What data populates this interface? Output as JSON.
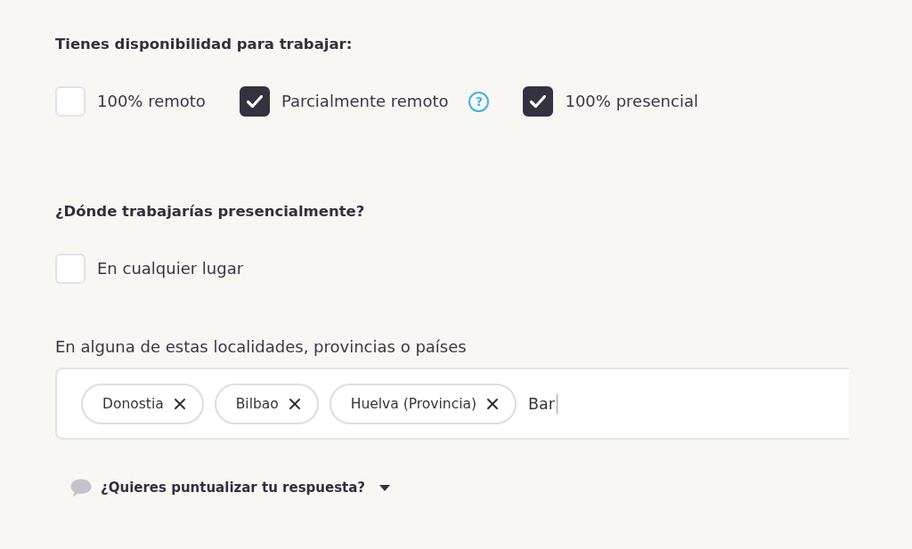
{
  "availability": {
    "title": "Tienes disponibilidad para trabajar:",
    "options": [
      {
        "label": "100% remoto",
        "checked": false
      },
      {
        "label": "Parcialmente remoto",
        "checked": true,
        "help": "?"
      },
      {
        "label": "100% presencial",
        "checked": true
      }
    ]
  },
  "location": {
    "title": "¿Dónde trabajarías presencialmente?",
    "anywhere": {
      "label": "En cualquier lugar",
      "checked": false
    },
    "places": {
      "label": "En alguna de estas localidades, provincias o países",
      "tags": [
        "Donostia",
        "Bilbao",
        "Huelva (Provincia)"
      ],
      "value": "Bar"
    }
  },
  "comment_toggle": {
    "label": "¿Quieres puntualizar tu respuesta?",
    "expanded": false
  }
}
